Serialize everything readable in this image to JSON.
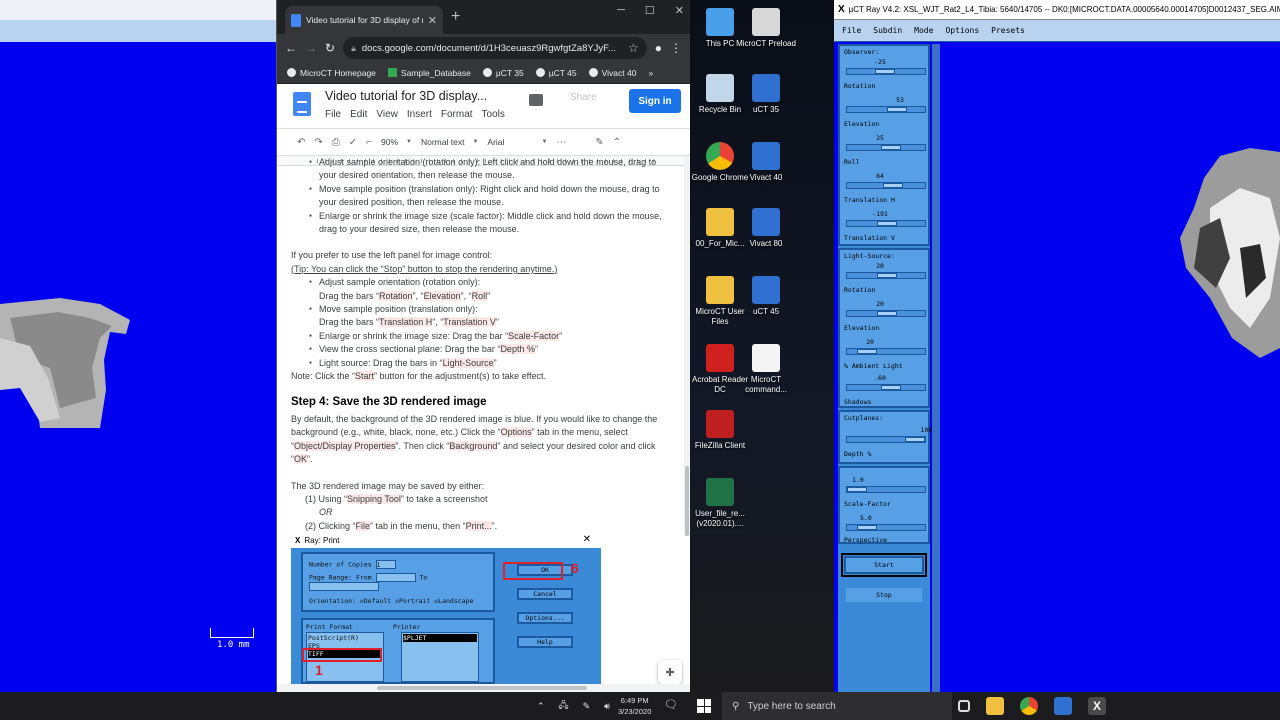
{
  "browser": {
    "tab_title": "Video tutorial for 3D display of m",
    "url": "docs.google.com/document/d/1H3ceuasz9RgwfgtZa8YJyF...",
    "bookmarks": [
      "MicroCT Homepage",
      "Sample_Database",
      "µCT 35",
      "µCT 45",
      "Vivact 40"
    ]
  },
  "docs": {
    "title": "Video tutorial for 3D display...",
    "menu": [
      "File",
      "Edit",
      "View",
      "Insert",
      "Format",
      "Tools"
    ],
    "share_label": "Share",
    "signin_label": "Sign in",
    "zoom": "90%",
    "style": "Normal text",
    "font": "Arial"
  },
  "doc": {
    "bullets_top": [
      "Adjust sample orientation (rotation only): Left click and hold down the mouse, drag to your desired orientation, then release the mouse.",
      "Move sample position (translation only): Right click and hold down the mouse, drag to your desired position, then release the mouse.",
      "Enlarge or shrink the image size (scale factor): Middle click and hold down the mouse, drag to your desired size, then release the mouse."
    ],
    "left_panel_intro": "If you prefer to use the left panel for image control:",
    "tip": "(Tip: You can click the “Stop” button to stop the rendering anytime.)",
    "b1": "Adjust sample orientation (rotation only):",
    "b1b_pre": "Drag the bars “",
    "b1b_h1": "Rotation",
    "b1b_h2": "Elevation",
    "b1b_h3": "Roll",
    "b2": "Move sample position (translation only):",
    "b2b_pre": "Drag the bars “",
    "b2b_h1": "Translation H",
    "b2b_h2": "Translation V",
    "b3_pre": "Enlarge or shrink the image size: Drag the bar “",
    "b3_h": "Scale-Factor",
    "b4_pre": "View the cross sectional plane: Drag the bar “",
    "b4_h": "Depth %",
    "b5_pre": "Light source: Drag the bars in “",
    "b5_h": "Light-Source",
    "note_pre": "Note: Click the “",
    "note_h": "Start",
    "note_post": "” button for the adjustment(s) to take effect.",
    "step4": "Step 4:  Save the 3D rendered image",
    "p1_a": "By default, the background of the 3D rendered image is blue. If you would like to change the background (e.g., white, black, none, etc.) Click the “",
    "p1_h1": "Options",
    "p1_b": "” tab in the menu, select “",
    "p1_h2": "Object/Display Properties",
    "p1_c": "”. Then click “",
    "p1_h3": "Background",
    "p1_d": "” and select your desired color and click “",
    "p1_h4": "OK",
    "p1_e": "”.",
    "p2": "The 3D rendered image may be saved by either:",
    "opt1_pre": "(1) Using “",
    "opt1_h": "Snipping Tool",
    "opt1_post": "” to take a screenshot",
    "or": "OR",
    "opt2_pre": "(2) Clicking “",
    "opt2_h1": "File",
    "opt2_mid": "” tab in the menu, then “",
    "opt2_h2": "Print...",
    "opt2_post": "”."
  },
  "ray_print": {
    "title": "Ray: Print",
    "copies_label": "Number of Copies",
    "copies_value": "1",
    "range_label": "Page Range: From",
    "to_label": "To",
    "orientation_label": "Orientation:",
    "orient_opts": [
      "Default",
      "Portrait",
      "Landscape"
    ],
    "ok": "OK",
    "cancel": "Cancel",
    "options": "Options...",
    "help": "Help",
    "format_label": "Print Format",
    "printer_label": "Printer",
    "formats": [
      "PostScript(R)",
      "EPS",
      "TIFF"
    ],
    "printer_value": "$PLJET",
    "num1": "1",
    "num6": "6"
  },
  "desktop_icons": [
    {
      "label": "This PC",
      "color": "#4aa0e8"
    },
    {
      "label": "MicroCT Preload",
      "color": "#d8d8d8"
    },
    {
      "label": "Recycle Bin",
      "color": "#c0d8e8"
    },
    {
      "label": "uCT 35",
      "color": "#3070d0"
    },
    {
      "label": "Google Chrome",
      "color": "#e04030"
    },
    {
      "label": "Vivact 40",
      "color": "#3070d0"
    },
    {
      "label": "00_For_Mic...",
      "color": "#f0c040"
    },
    {
      "label": "Vivact 80",
      "color": "#3070d0"
    },
    {
      "label": "MicroCT User Files",
      "color": "#f0c040"
    },
    {
      "label": "uCT 45",
      "color": "#3070d0"
    },
    {
      "label": "Acrobat Reader DC",
      "color": "#d02020"
    },
    {
      "label": "MicroCT command...",
      "color": "#f4f4f4"
    },
    {
      "label": "FileZilla Client",
      "color": "#c02020"
    },
    {
      "label": "User_file_re... (v2020.01)....",
      "color": "#1f7244"
    }
  ],
  "uct": {
    "title": "µCT Ray V4.2: XSL_WJT_Rat2_L4_Tibia: 5640/14705 -- DK0:[MICROCT.DATA.00005640.00014705]D0012437_SEG.AIM;1",
    "menu": [
      "File",
      "Subdin",
      "Mode",
      "Options",
      "Presets"
    ],
    "observer_label": "Observer:",
    "observer_val": "-25",
    "rotation_label": "Rotation",
    "rotation_val": "53",
    "elevation_label": "Elevation",
    "elevation_val": "25",
    "roll_label": "Roll",
    "roll_val": "64",
    "transh_label": "Translation H",
    "transh_val": "-191",
    "transv_label": "Translation V",
    "light_label": "Light-Source:",
    "light_val": "20",
    "lrot_label": "Rotation",
    "lrot_val": "20",
    "lelev_label": "Elevation",
    "lelev_val": "20",
    "ambient_label": "% Ambient Light",
    "ambient_val": ".60",
    "shadows_label": "Shadows",
    "cut_label": "Cutplanes:",
    "cut_val": "100.0",
    "depth_label": "Depth %",
    "scale_val": "1.0",
    "scale_label": "Scale-Factor",
    "persp_val": "5.0",
    "persp_label": "Perspective",
    "start": "Start",
    "stop": "Stop"
  },
  "scale_label": "1.0 mm",
  "taskbar": {
    "time": "6:49 PM",
    "date": "3/23/2020",
    "search_placeholder": "Type here to search"
  }
}
